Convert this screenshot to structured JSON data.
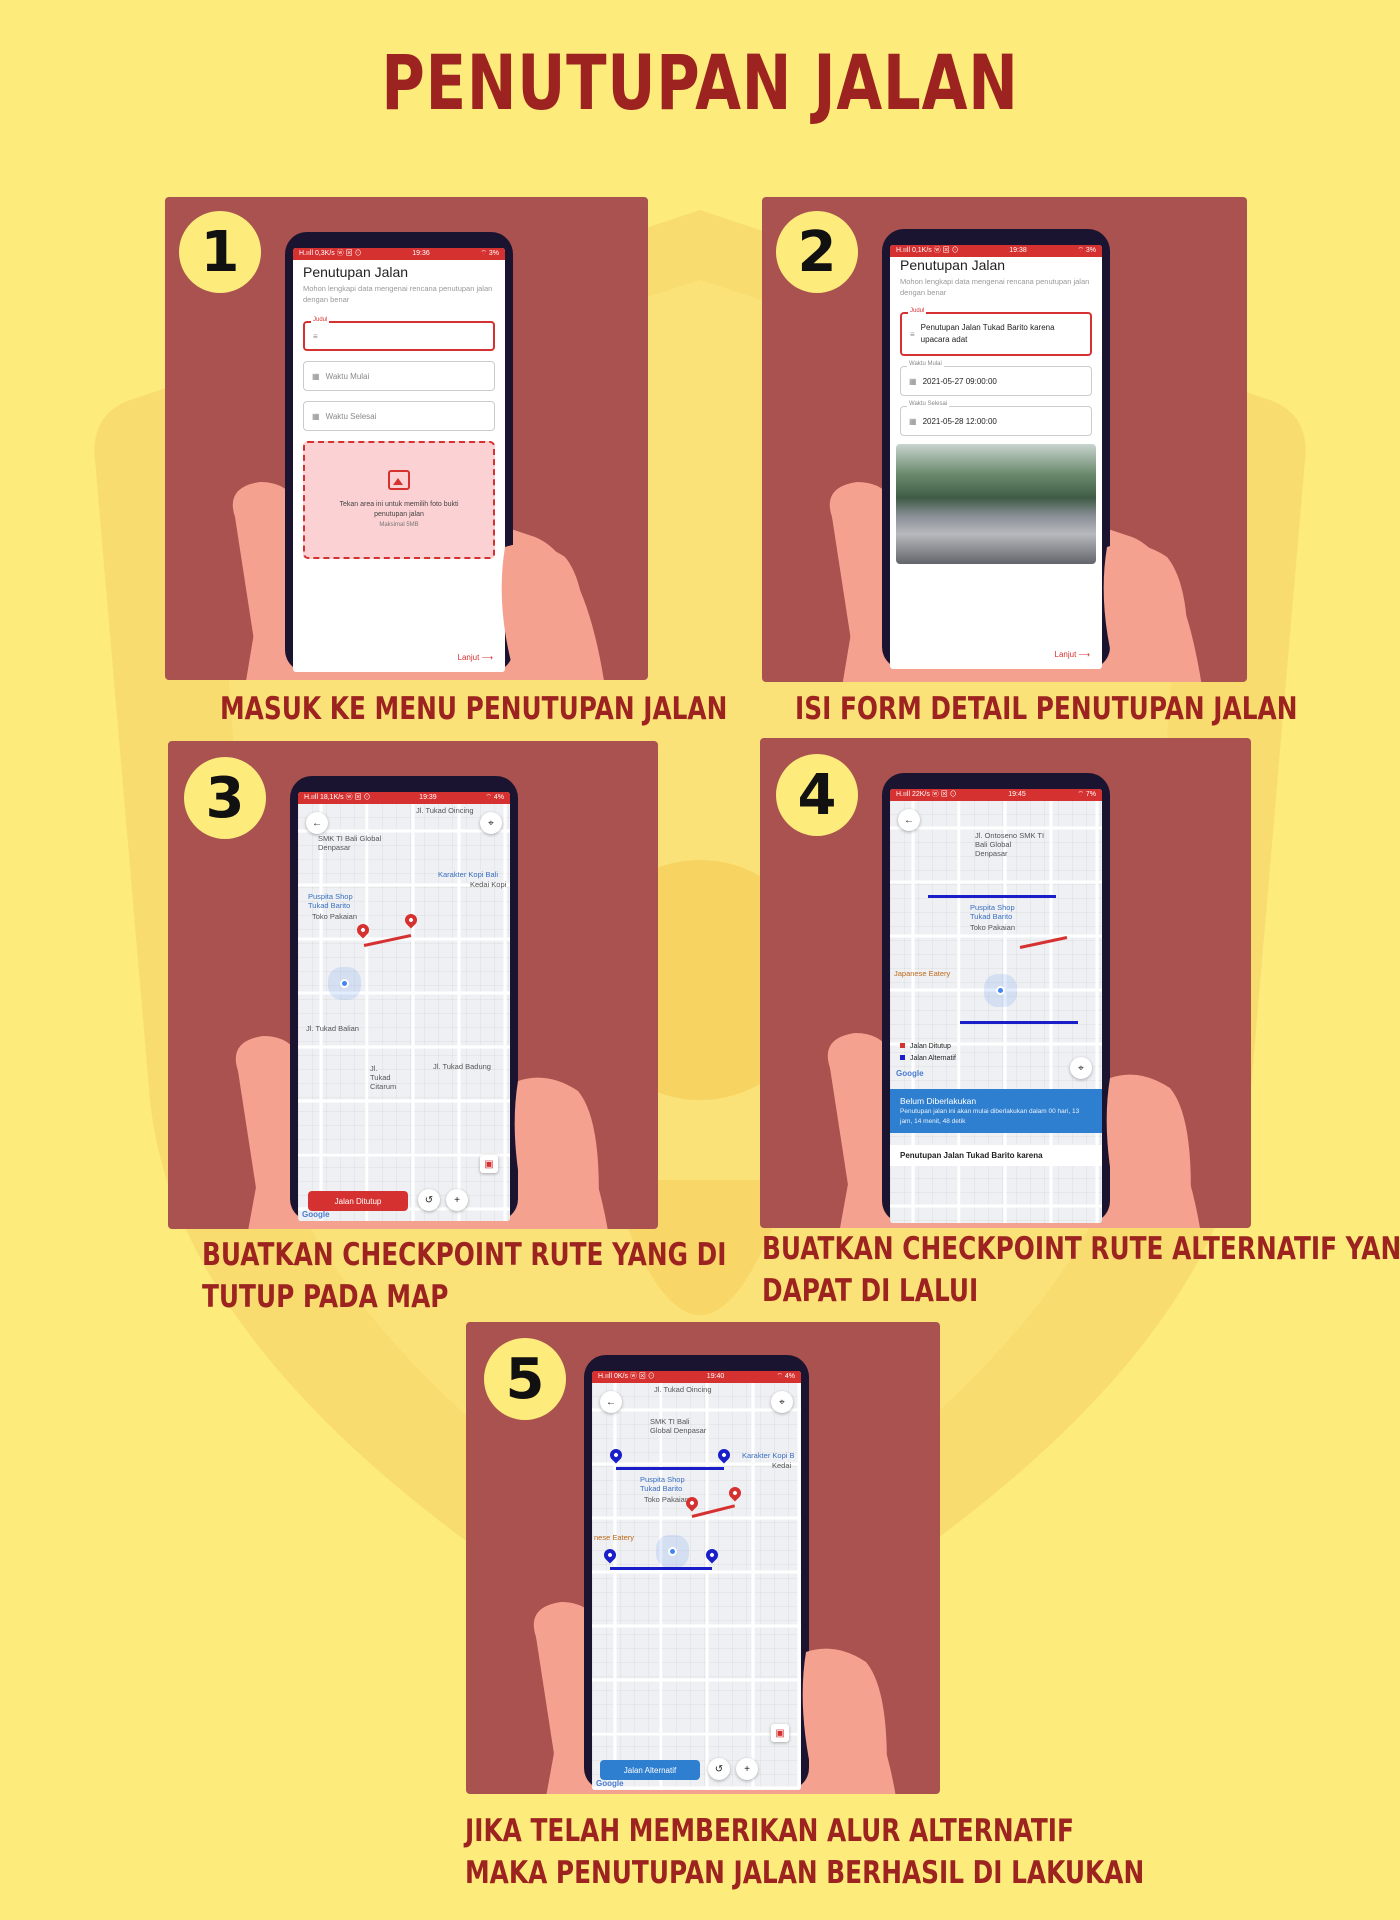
{
  "title": "PENUTUPAN JALAN",
  "steps": [
    {
      "number": "1",
      "caption": [
        "MASUK KE MENU PENUTUPAN JALAN"
      ]
    },
    {
      "number": "2",
      "caption": [
        "ISI FORM DETAIL PENUTUPAN JALAN"
      ]
    },
    {
      "number": "3",
      "caption": [
        "BUATKAN CHECKPOINT RUTE YANG DI",
        "TUTUP PADA MAP"
      ]
    },
    {
      "number": "4",
      "caption": [
        "BUATKAN CHECKPOINT RUTE ALTERNATIF YANG",
        "DAPAT DI LALUI"
      ]
    },
    {
      "number": "5",
      "caption": [
        "JIKA TELAH MEMBERIKAN ALUR ALTERNATIF",
        "MAKA PENUTUPAN JALAN BERHASIL DI LAKUKAN"
      ]
    }
  ],
  "screen1": {
    "status_left": "H.ııll 0,3K/s ⓦ ⊠ ⊙",
    "time": "19:36",
    "status_right": "⌔ 3%",
    "form_title": "Penutupan Jalan",
    "form_subtitle": "Mohon lengkapi data mengenai rencana penutupan jalan dengan benar",
    "field_judul_label": "Judul",
    "field_mulai_placeholder": "Waktu Mulai",
    "field_selesai_placeholder": "Waktu Selesai",
    "upload_text": "Tekan area ini untuk memilih foto bukti penutupan jalan",
    "upload_limit": "Maksimal 5MB",
    "next_label": "Lanjut"
  },
  "screen2": {
    "status_left": "H.ııll 0,1K/s ⓦ ⊠ ⊙",
    "time": "19:38",
    "status_right": "⌔ 3%",
    "form_title": "Penutupan Jalan",
    "form_subtitle": "Mohon lengkapi data mengenai rencana penutupan jalan dengan benar",
    "field_judul_label": "Judul",
    "field_judul_value": "Penutupan Jalan Tukad Barito karena upacara adat",
    "field_mulai_label": "Waktu Mulai",
    "field_mulai_value": "2021-05-27 09:00:00",
    "field_selesai_label": "Waktu Selesai",
    "field_selesai_value": "2021-05-28 12:00:00",
    "next_label": "Lanjut"
  },
  "screen3": {
    "status_left": "H.ııll 18,1K/s ⓦ ⊠ ⊙",
    "time": "19:39",
    "status_right": "⌔ 4%",
    "map_labels": {
      "school": "SMK TI Bali Global Denpasar",
      "cafe": "Karakter Kopi Bali",
      "cafe_sub": "Kedai Kopi",
      "shop": "Puspita Shop Tukad Barito",
      "shop_sub": "Toko Pakaian",
      "road1": "Jl. Tukad Oincing",
      "road2": "Jl. Tukad Balian",
      "road3": "Jl. Tukad Badung",
      "road4": "Jl. Tukad Citarum"
    },
    "button_label": "Jalan Ditutup",
    "google": "Google",
    "closed_color": "#d63131"
  },
  "screen4": {
    "status_left": "H.ııll 22K/s ⓦ ⊠ ⊙",
    "time": "19:45",
    "status_right": "⌔ 7%",
    "map_labels": {
      "school": "Jl. Ontoseno SMK TI Bali Global Denpasar",
      "shop": "Puspita Shop Tukad Barito",
      "shop_sub": "Toko Pakaian",
      "eatery": "Japanese Eatery"
    },
    "legend_closed": "Jalan Ditutup",
    "legend_alt": "Jalan Alternatif",
    "google": "Google",
    "info_title": "Belum Diberlakukan",
    "info_text": "Penutupan jalan ini akan mulai diberlakukan dalam 00 hari, 13 jam, 14 menit, 48 detik",
    "info_footer": "Penutupan Jalan Tukad Barito karena",
    "closed_color": "#d63131",
    "alt_color": "#1a1ec8"
  },
  "screen5": {
    "status_left": "H.ııll 0K/s ⓦ ⊠ ⊙",
    "time": "19:40",
    "status_right": "⌔ 4%",
    "map_labels": {
      "school": "SMK TI Bali Global Denpasar",
      "cafe": "Karakter Kopi B",
      "cafe_sub": "Kedai",
      "shop": "Puspita Shop Tukad Barito",
      "shop_sub": "Toko Pakaian",
      "eatery": "nese Eatery",
      "road1": "Jl. Tukad Oincing"
    },
    "button_label": "Jalan Alternatif",
    "google": "Google",
    "closed_color": "#d63131",
    "alt_color": "#1a1ec8"
  },
  "colors": {
    "background": "#fdeb7c",
    "card": "#a9524f",
    "accent_red": "#9c2320",
    "app_red": "#d63131",
    "app_blue": "#2e7fd0"
  }
}
